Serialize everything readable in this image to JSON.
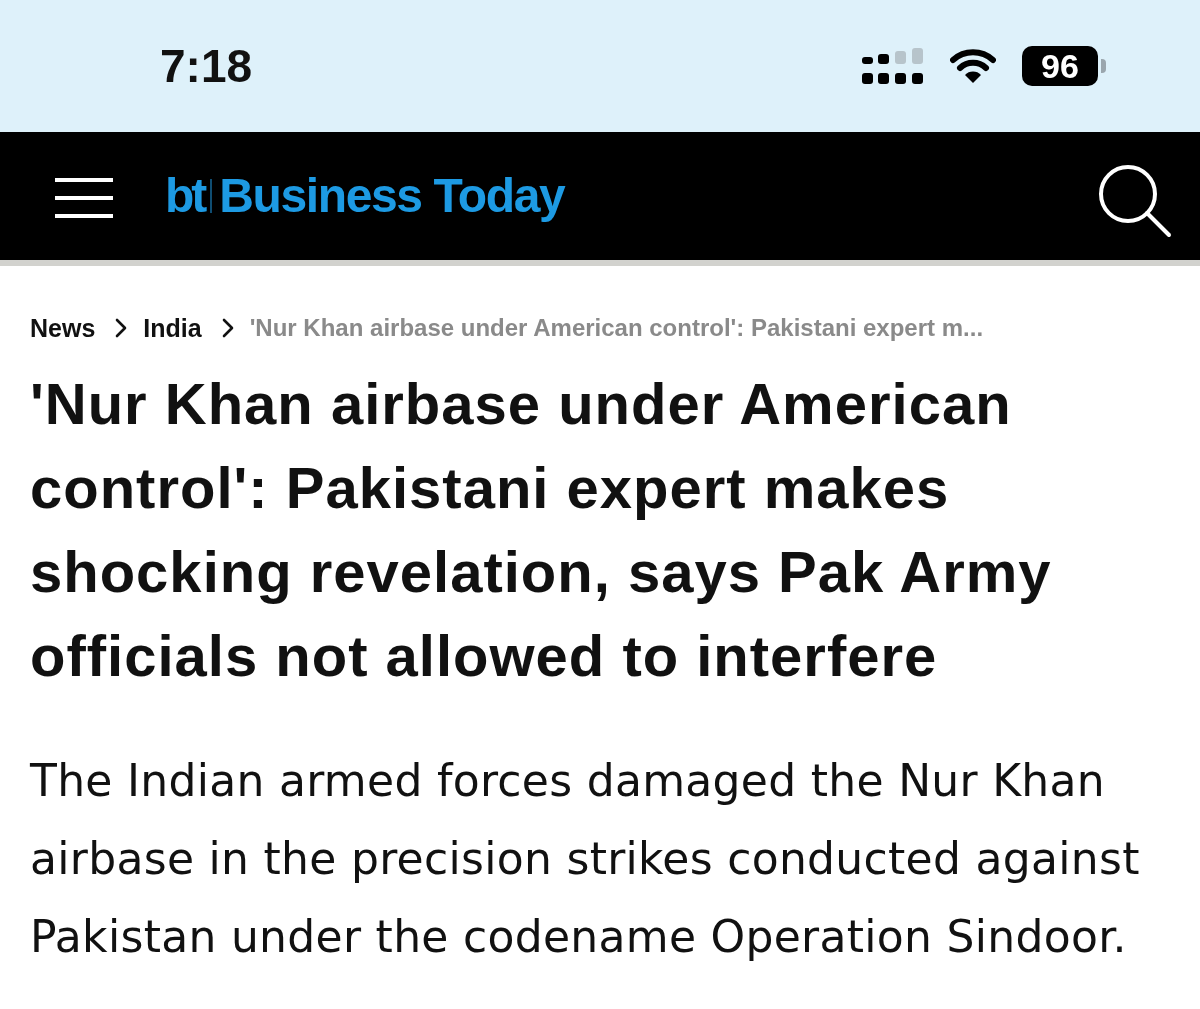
{
  "status_bar": {
    "time": "7:18",
    "battery": "96"
  },
  "header": {
    "logo_mark": "bt",
    "logo_text": "Business Today"
  },
  "breadcrumbs": [
    {
      "label": "News",
      "current": false
    },
    {
      "label": "India",
      "current": false
    },
    {
      "label": "'Nur Khan airbase under American control': Pakistani expert m...",
      "current": true
    }
  ],
  "headline": "'Nur Khan airbase under American control': Pakistani expert makes shocking revelation, says Pak Army officials not allowed to interfere",
  "summary": "The Indian armed forces damaged the Nur Khan airbase in the precision strikes conducted against Pakistan under the codename Operation Sindoor."
}
